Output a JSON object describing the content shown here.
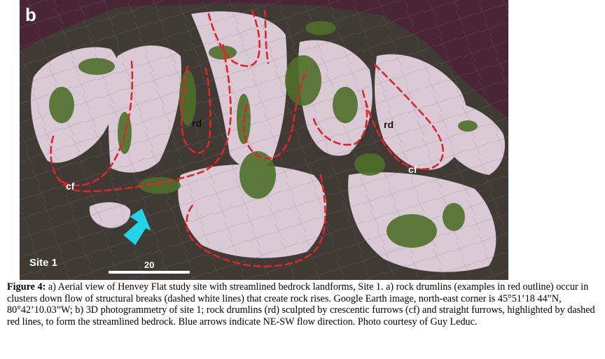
{
  "figure": {
    "panel_letter": "b",
    "site_label": "Site 1",
    "scale_label": "20",
    "annotations": {
      "rd_1": "rd",
      "rd_2": "rd",
      "cf_1": "cf",
      "cf_2": "cf"
    },
    "colors": {
      "background": "#4a2535",
      "rock": "#d9cad6",
      "vegetation": "#4e6f2a",
      "outline": "#e0242a",
      "arrow": "#22d4e8"
    }
  },
  "caption": {
    "label": "Figure 4:",
    "text": " a) Aerial view of Henvey Flat study site with streamlined bedrock landforms, Site 1. a) rock drumlins (examples in red outline) occur in clusters down flow of structural breaks (dashed white lines) that create rock rises. Google Earth image, north-east corner is 45°51’18 44”N, 80°42’10.03”W; b) 3D photogrammetry of site 1; rock drumlins (rd) sculpted by crescentic furrows (cf) and straight furrows, highlighted by dashed red lines, to form the streamlined bedrock. Blue arrows indicate NE-SW flow direction. Photo courtesy of Guy Leduc."
  }
}
